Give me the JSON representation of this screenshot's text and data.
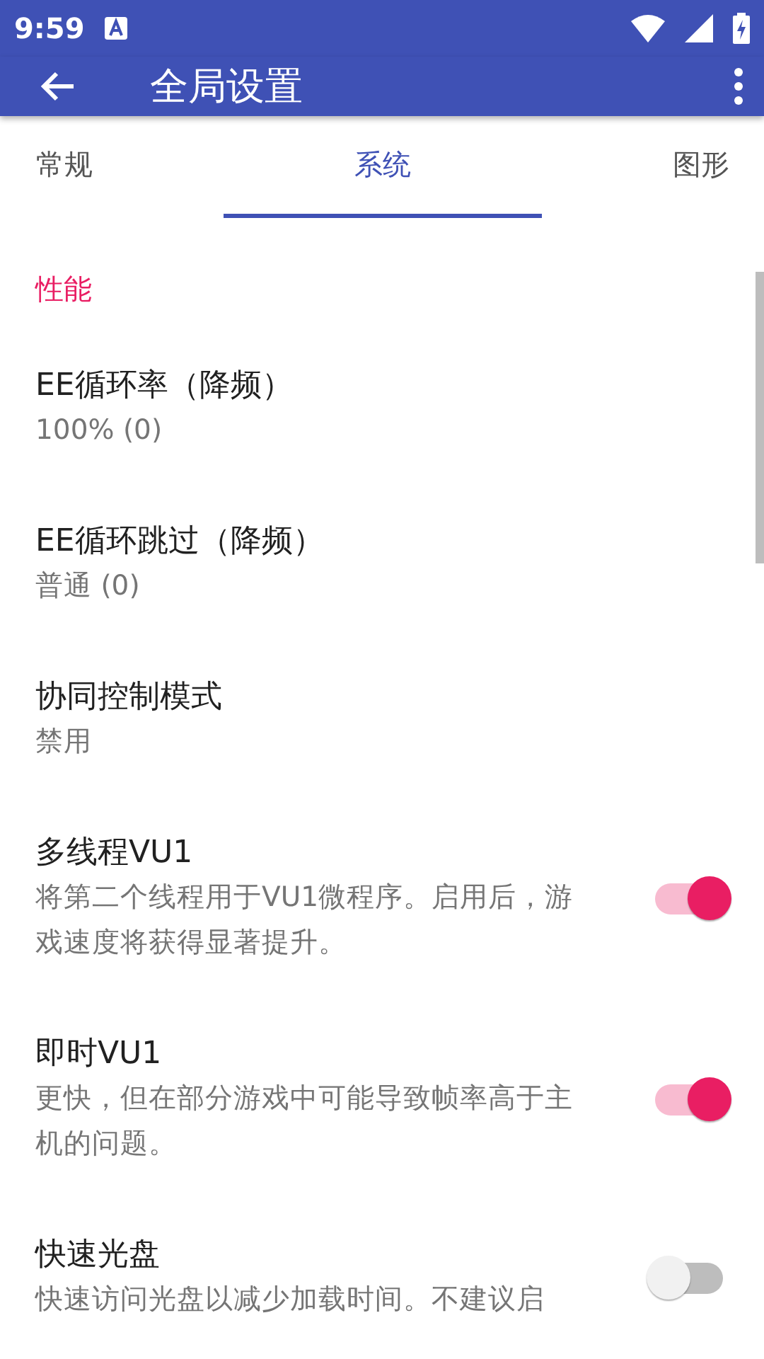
{
  "status_bar": {
    "time": "9:59"
  },
  "app_bar": {
    "title": "全局设置"
  },
  "tabs": [
    {
      "label": "常规",
      "selected": false
    },
    {
      "label": "系统",
      "selected": true
    },
    {
      "label": "图形",
      "selected": false
    }
  ],
  "sections": [
    {
      "title": "性能",
      "items": [
        {
          "kind": "text",
          "title": "EE循环率（降频）",
          "summary": "100% (0)"
        },
        {
          "kind": "text",
          "title": "EE循环跳过（降频）",
          "summary": "普通 (0)"
        },
        {
          "kind": "text",
          "title": "协同控制模式",
          "summary": "禁用"
        },
        {
          "kind": "switch",
          "title": "多线程VU1",
          "summary": "将第二个线程用于VU1微程序。启用后，游戏速度将获得显著提升。",
          "on": true
        },
        {
          "kind": "switch",
          "title": "即时VU1",
          "summary": "更快，但在部分游戏中可能导致帧率高于主机的问题。",
          "on": true
        },
        {
          "kind": "switch",
          "title": "快速光盘",
          "summary": "快速访问光盘以减少加载时间。不建议启",
          "on": false
        }
      ]
    }
  ]
}
